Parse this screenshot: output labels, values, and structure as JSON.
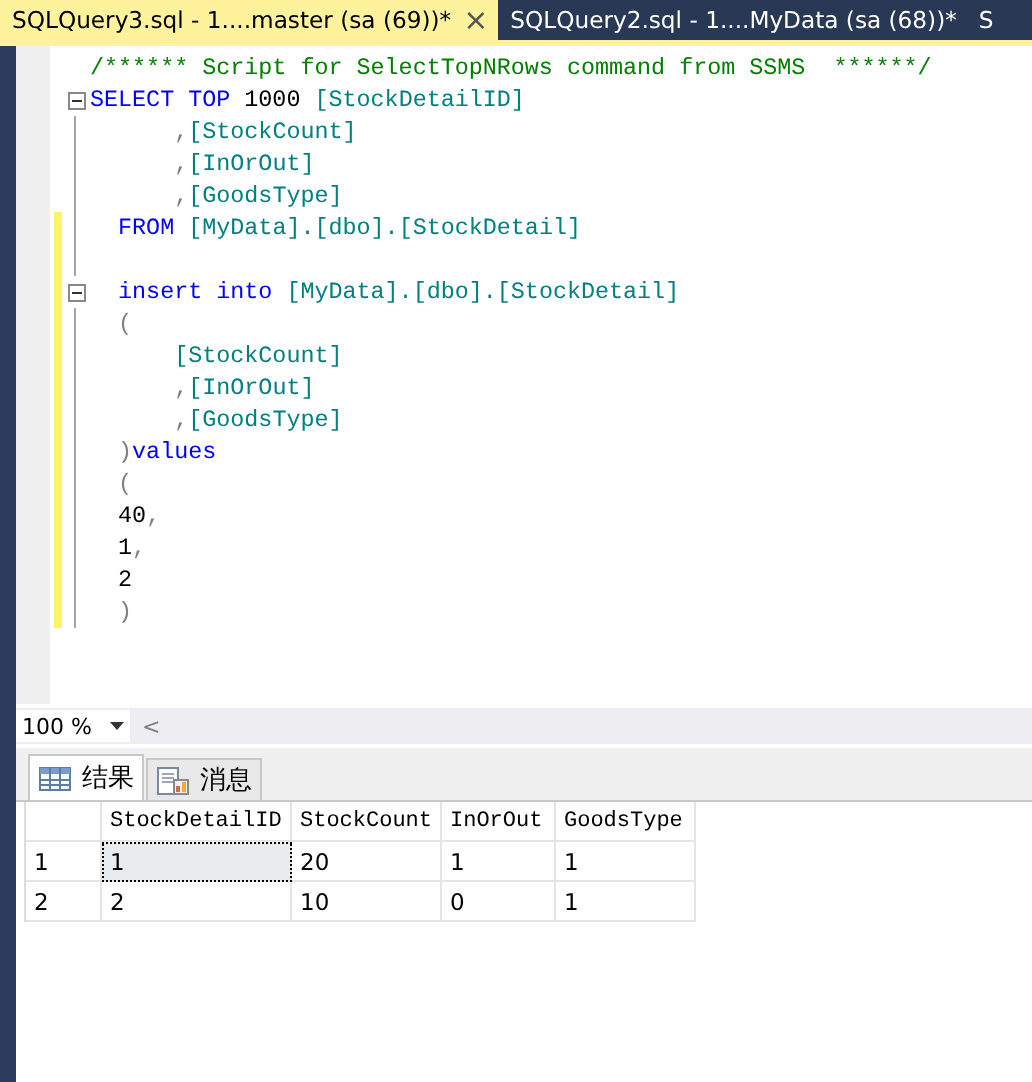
{
  "document_tabs": [
    {
      "label": "SQLQuery3.sql - 1....master (sa (69))*",
      "selected": true
    },
    {
      "label": "SQLQuery2.sql - 1....MyData (sa (68))*",
      "selected": false
    },
    {
      "label": "S",
      "selected": false
    }
  ],
  "close_symbol": "×",
  "editor": {
    "lines": [
      {
        "changed": false,
        "fold": false,
        "tokens": [
          {
            "kind": "comment",
            "text": "/****** Script for SelectTopNRows command from SSMS  ******/"
          }
        ]
      },
      {
        "changed": false,
        "fold": true,
        "tokens": [
          {
            "kind": "keyword",
            "text": "SELECT TOP "
          },
          {
            "kind": "plain",
            "text": "1000 "
          },
          {
            "kind": "ident",
            "text": "[StockDetailID]"
          }
        ]
      },
      {
        "changed": false,
        "fold": false,
        "tokens": [
          {
            "kind": "punct",
            "text": "      ,"
          },
          {
            "kind": "ident",
            "text": "[StockCount]"
          }
        ]
      },
      {
        "changed": false,
        "fold": false,
        "tokens": [
          {
            "kind": "punct",
            "text": "      ,"
          },
          {
            "kind": "ident",
            "text": "[InOrOut]"
          }
        ]
      },
      {
        "changed": false,
        "fold": false,
        "tokens": [
          {
            "kind": "punct",
            "text": "      ,"
          },
          {
            "kind": "ident",
            "text": "[GoodsType]"
          }
        ]
      },
      {
        "changed": true,
        "fold": false,
        "tokens": [
          {
            "kind": "keyword",
            "text": "  FROM "
          },
          {
            "kind": "ident",
            "text": "[MyData].[dbo].[StockDetail]"
          }
        ]
      },
      {
        "changed": true,
        "fold": false
      },
      {
        "changed": true,
        "fold": true,
        "tokens": [
          {
            "kind": "keyword",
            "text": "  insert into "
          },
          {
            "kind": "ident",
            "text": "[MyData].[dbo].[StockDetail]"
          }
        ]
      },
      {
        "changed": true,
        "fold": false,
        "tokens": [
          {
            "kind": "punct",
            "text": "  ("
          }
        ]
      },
      {
        "changed": true,
        "fold": false,
        "tokens": [
          {
            "kind": "ident",
            "text": "      [StockCount]"
          }
        ]
      },
      {
        "changed": true,
        "fold": false,
        "tokens": [
          {
            "kind": "punct",
            "text": "      ,"
          },
          {
            "kind": "ident",
            "text": "[InOrOut]"
          }
        ]
      },
      {
        "changed": true,
        "fold": false,
        "tokens": [
          {
            "kind": "punct",
            "text": "      ,"
          },
          {
            "kind": "ident",
            "text": "[GoodsType]"
          }
        ]
      },
      {
        "changed": true,
        "fold": false,
        "tokens": [
          {
            "kind": "punct",
            "text": "  )"
          },
          {
            "kind": "keyword",
            "text": "values"
          }
        ]
      },
      {
        "changed": true,
        "fold": false,
        "tokens": [
          {
            "kind": "punct",
            "text": "  ("
          }
        ]
      },
      {
        "changed": true,
        "fold": false,
        "tokens": [
          {
            "kind": "plain",
            "text": "  40"
          },
          {
            "kind": "punct",
            "text": ","
          }
        ]
      },
      {
        "changed": true,
        "fold": false,
        "tokens": [
          {
            "kind": "plain",
            "text": "  1"
          },
          {
            "kind": "punct",
            "text": ","
          }
        ]
      },
      {
        "changed": true,
        "fold": false,
        "tokens": [
          {
            "kind": "plain",
            "text": "  2"
          }
        ]
      },
      {
        "changed": true,
        "fold": false,
        "tokens": [
          {
            "kind": "punct",
            "text": "  )"
          }
        ]
      }
    ]
  },
  "zoom": {
    "value": "100 %",
    "scroll_arrow": "<"
  },
  "result_tabs": [
    {
      "label": "结果",
      "selected": true,
      "kind": "grid"
    },
    {
      "label": "消息",
      "selected": false,
      "kind": "messages"
    }
  ],
  "grid": {
    "columns": [
      "StockDetailID",
      "StockCount",
      "InOrOut",
      "GoodsType"
    ],
    "rows": [
      {
        "number": "1",
        "cells": [
          {
            "text": "1",
            "selected": true
          },
          {
            "text": "20",
            "selected": false
          },
          {
            "text": "1",
            "selected": false
          },
          {
            "text": "1",
            "selected": false
          }
        ]
      },
      {
        "number": "2",
        "cells": [
          {
            "text": "2",
            "selected": false
          },
          {
            "text": "10",
            "selected": false
          },
          {
            "text": "0",
            "selected": false
          },
          {
            "text": "1",
            "selected": false
          }
        ]
      }
    ]
  }
}
